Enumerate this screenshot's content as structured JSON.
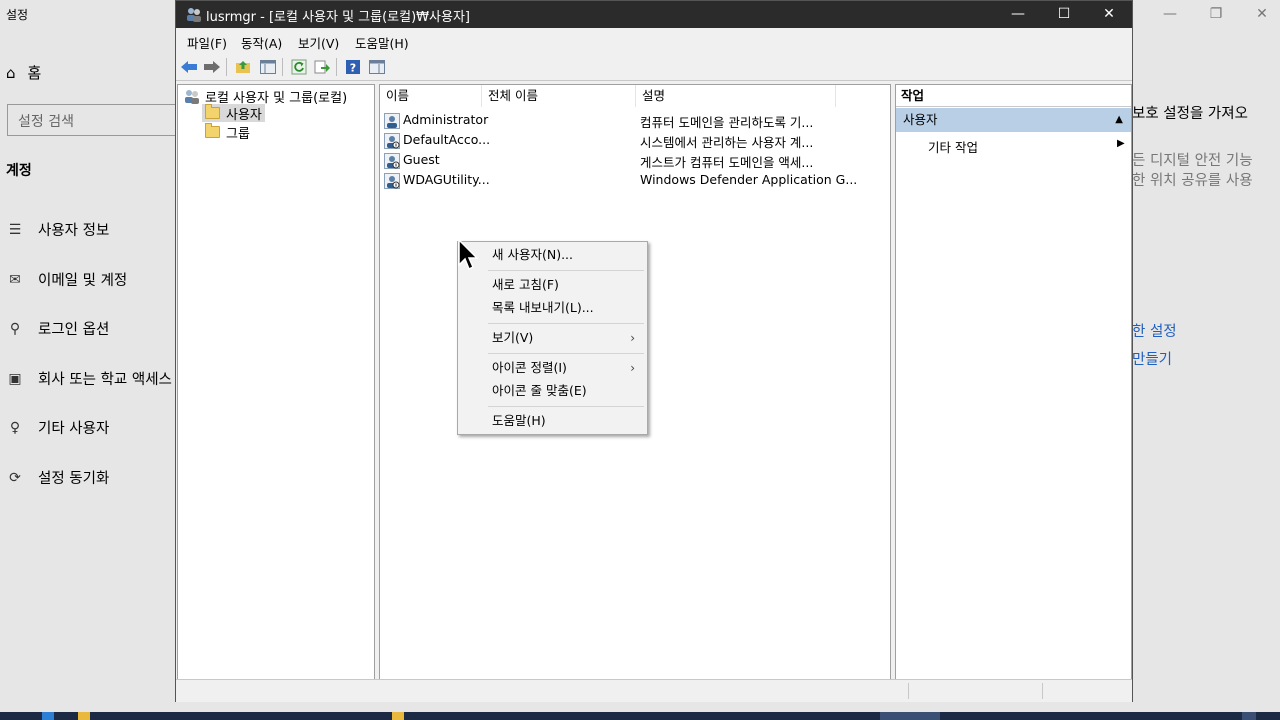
{
  "settings": {
    "title": "설정",
    "home_label": "홈",
    "search_placeholder": "설정 검색",
    "section_title": "계정",
    "nav": [
      {
        "label": "사용자 정보",
        "icon": "user-info-icon"
      },
      {
        "label": "이메일 및 계정",
        "icon": "mail-icon"
      },
      {
        "label": "로그인 옵션",
        "icon": "key-icon"
      },
      {
        "label": "회사 또는 학교 액세스",
        "icon": "briefcase-icon"
      },
      {
        "label": "기타 사용자",
        "icon": "person-add-icon"
      },
      {
        "label": "설정 동기화",
        "icon": "sync-icon"
      }
    ],
    "right_text": {
      "line1": "보호 설정을 가져오",
      "line2": "든 디지털 안전 기능",
      "line3": "한 위치 공유를 사용",
      "link1": "한 설정",
      "link2": "만들기"
    }
  },
  "window": {
    "title": "lusrmgr - [로컬 사용자 및 그룹(로컬)₩사용자]",
    "menu": [
      "파일(F)",
      "동작(A)",
      "보기(V)",
      "도움말(H)"
    ],
    "toolbar_icons": [
      "back-arrow-icon",
      "forward-arrow-icon",
      "up-folder-icon",
      "show-tree-icon",
      "refresh-icon",
      "export-icon",
      "help-icon",
      "action-pane-icon"
    ]
  },
  "tree": {
    "root": "로컬 사용자 및 그룹(로컬)",
    "items": [
      "사용자",
      "그룹"
    ],
    "selected": "사용자"
  },
  "list": {
    "columns": [
      "이름",
      "전체 이름",
      "설명"
    ],
    "rows": [
      {
        "name": "Administrator",
        "full_name": "",
        "description": "컴퓨터 도메인을 관리하도록 기..."
      },
      {
        "name": "DefaultAcco...",
        "full_name": "",
        "description": "시스템에서 관리하는 사용자 계..."
      },
      {
        "name": "Guest",
        "full_name": "",
        "description": "게스트가 컴퓨터 도메인을 액세..."
      },
      {
        "name": "WDAGUtility...",
        "full_name": "",
        "description": "Windows Defender Application G..."
      }
    ]
  },
  "actions": {
    "header": "작업",
    "section": "사용자",
    "item": "기타 작업"
  },
  "context_menu": {
    "items": [
      {
        "label": "새 사용자(N)...",
        "submenu": false
      },
      {
        "label": "새로 고침(F)",
        "submenu": false
      },
      {
        "label": "목록 내보내기(L)...",
        "submenu": false
      },
      {
        "label": "보기(V)",
        "submenu": true
      },
      {
        "label": "아이콘 정렬(I)",
        "submenu": true
      },
      {
        "label": "아이콘 줄 맞춤(E)",
        "submenu": false
      },
      {
        "label": "도움말(H)",
        "submenu": false
      }
    ]
  },
  "colors": {
    "titlebar": "#2b2b2b",
    "action_section": "#b8cfe6",
    "link": "#1f5fbd",
    "selection": "#d9d9d9"
  }
}
